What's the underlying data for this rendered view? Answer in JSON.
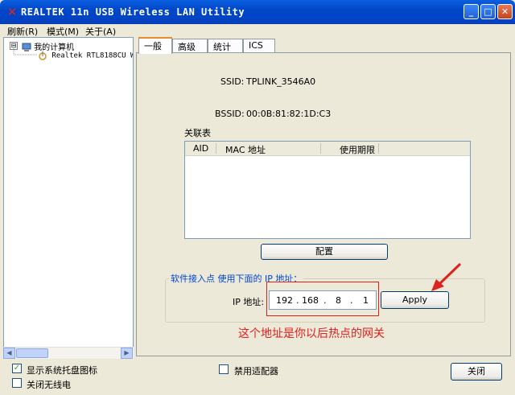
{
  "window": {
    "title": "REALTEK 11n USB Wireless LAN Utility",
    "minimize_glyph": "_",
    "maximize_glyph": "□",
    "close_glyph": "✕"
  },
  "menu": {
    "items": [
      "刷新(R)",
      "模式(M)",
      "关于(A)"
    ]
  },
  "tree": {
    "expander": "⊟",
    "root_label": "我的计算机",
    "child_label": "Realtek RTL8188CU W"
  },
  "tabs": [
    "一般",
    "高级",
    "统计",
    "ICS"
  ],
  "general": {
    "ssid_label": "SSID:",
    "ssid_value": "TPLINK_3546A0",
    "bssid_label": "BSSID:",
    "bssid_value": "00:0B:81:82:1D:C3",
    "assoc_table_label": "关联表",
    "columns": [
      "AID",
      "MAC 地址",
      "使用期限"
    ],
    "config_button": "配置"
  },
  "softap": {
    "group_title": "软件接入点 使用下面的 IP 地址：",
    "ip_label": "IP 地址:",
    "ip_octets": [
      "192",
      "168",
      "8",
      "1"
    ],
    "ip_dot": ".",
    "apply_button": "Apply"
  },
  "annotation": {
    "text": "这个地址是你以后热点的网关",
    "color": "#e0201d"
  },
  "footer": {
    "show_tray_icon": "显示系统托盘图标",
    "show_tray_checked": true,
    "disable_adapter": "禁用适配器",
    "disable_checked": false,
    "radio_off": "关闭无线电",
    "radio_checked": false,
    "close_button": "关闭"
  },
  "colors": {
    "titlebar": "#0047c8",
    "accent_tab": "#e68b2c",
    "group_title": "#0046d5"
  }
}
